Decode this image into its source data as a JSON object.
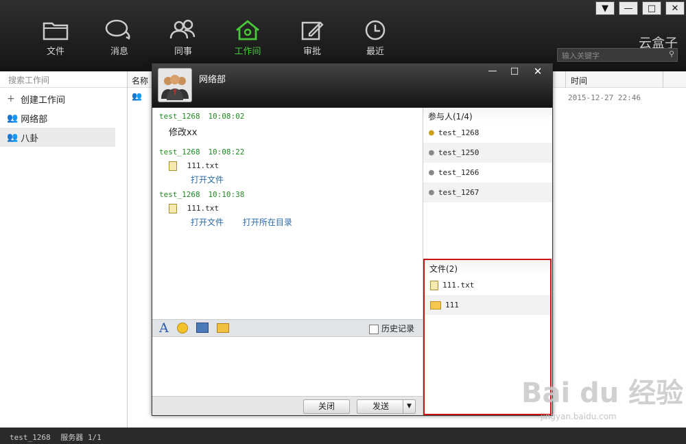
{
  "nav": [
    {
      "label": "文件",
      "icon": "folder-icon"
    },
    {
      "label": "消息",
      "icon": "chat-bubbles-icon"
    },
    {
      "label": "同事",
      "icon": "colleagues-icon"
    },
    {
      "label": "工作间",
      "icon": "workspace-icon",
      "active": true
    },
    {
      "label": "审批",
      "icon": "edit-icon"
    },
    {
      "label": "最近",
      "icon": "clock-icon"
    }
  ],
  "brand": "云盒子",
  "search": {
    "placeholder": "输入关键字"
  },
  "sidebar": {
    "search_placeholder": "搜索工作间",
    "create": "创建工作间",
    "items": [
      {
        "label": "网络部"
      },
      {
        "label": "八卦"
      }
    ]
  },
  "main": {
    "col_name": "名称",
    "col_time": "时间",
    "row_timestamp": "2015-12-27 22:46"
  },
  "dialog": {
    "title": "网络部",
    "messages": [
      {
        "user": "test_1268",
        "time": "10:08:02",
        "text": "修改xx"
      },
      {
        "user": "test_1268",
        "time": "10:08:22",
        "file": "111.txt",
        "actions": [
          "打开文件"
        ]
      },
      {
        "user": "test_1268",
        "time": "10:10:38",
        "file": "111.txt",
        "actions": [
          "打开文件",
          "打开所在目录"
        ]
      }
    ],
    "history": "历史记录",
    "close_btn": "关闭",
    "send_btn": "发送",
    "participants_title": "参与人(1/4)",
    "participants": [
      "test_1268",
      "test_1250",
      "test_1266",
      "test_1267"
    ],
    "files_title": "文件(2)",
    "files": [
      "111.txt",
      "111"
    ]
  },
  "status": {
    "user": "test_1268",
    "server": "服务器 1/1"
  },
  "watermark": {
    "main": "Bai du 经验",
    "sub": "jingyan.baidu.com"
  },
  "colors": {
    "accent": "#49c83a",
    "highlight_border": "#d01010",
    "link": "#2a6aaa"
  }
}
